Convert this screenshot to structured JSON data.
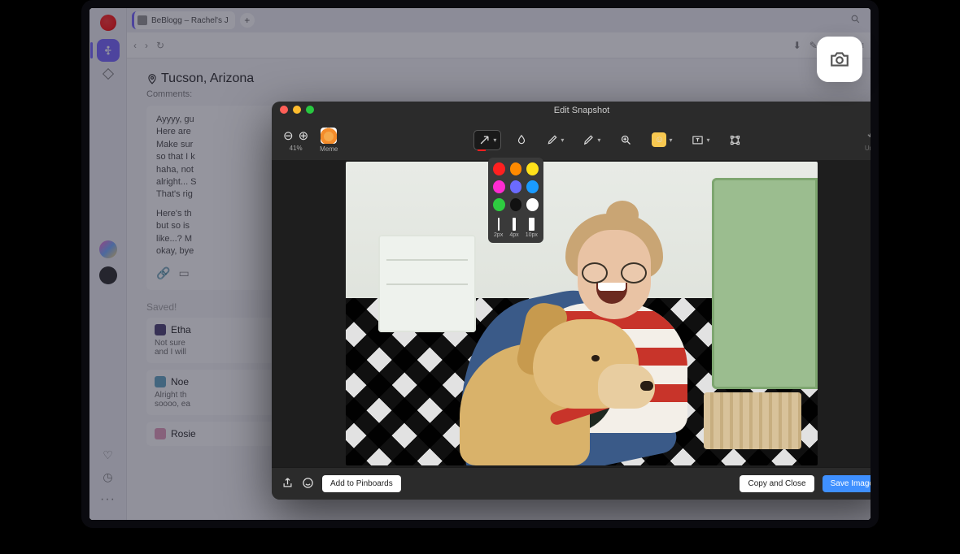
{
  "browser": {
    "tab_title": "BeBlogg – Rachel's J",
    "nav": {
      "back": "‹",
      "forward": "›",
      "reload": "↻"
    },
    "right_tools": [
      "⬇",
      "✎",
      "⊞",
      "⊡",
      "≡"
    ]
  },
  "page": {
    "location_label": "Tucson, Arizona",
    "comments_label": "Comments:",
    "post_lines_a": [
      "Ayyyy, gu",
      "Here are",
      "Make sur",
      "so that I k",
      "haha, not",
      "alright... S",
      "That's rig"
    ],
    "post_lines_b": [
      "Here's th",
      "but so is",
      "like...? M",
      "okay, bye"
    ],
    "saved_label": "Saved!",
    "items": [
      {
        "name": "Etha",
        "body": "Not sure",
        "body2": "and I will"
      },
      {
        "name": "Noe",
        "body": "Alright th",
        "body2": "soooo, ea"
      },
      {
        "name": "Rosie",
        "body": ""
      }
    ]
  },
  "editor": {
    "title": "Edit Snapshot",
    "zoom_label": "41%",
    "meme_label": "Meme",
    "undo_label": "Undo",
    "footer": {
      "pinboards": "Add to Pinboards",
      "copy_close": "Copy and Close",
      "save": "Save Image"
    }
  },
  "popover": {
    "colors": [
      [
        "#ff2020",
        "#ff8a00",
        "#ffe11a"
      ],
      [
        "#ff2bd1",
        "#6b6bff",
        "#1a9bff"
      ],
      [
        "#2ecc40",
        "#111111",
        "#ffffff"
      ]
    ],
    "sizes": [
      {
        "w": 2,
        "label": "2px"
      },
      {
        "w": 4,
        "label": "4px"
      },
      {
        "w": 7,
        "label": "10px"
      }
    ]
  }
}
